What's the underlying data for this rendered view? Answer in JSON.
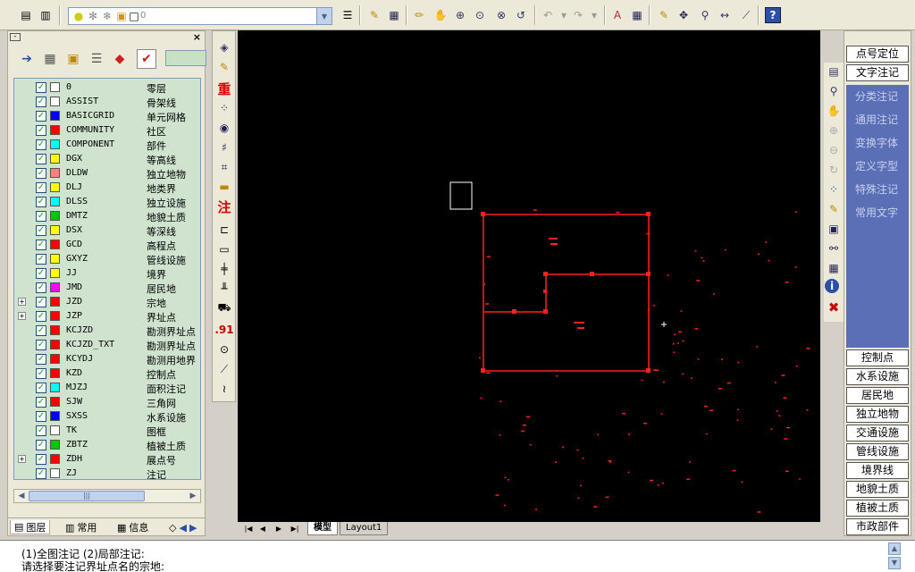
{
  "toolbar": {
    "layer_combo_value": "0"
  },
  "panel": {
    "layers": [
      {
        "name": "0",
        "desc": "零层",
        "color": "#ffffff",
        "expandable": false
      },
      {
        "name": "ASSIST",
        "desc": "骨架线",
        "color": "#ffffff",
        "expandable": false
      },
      {
        "name": "BASICGRID",
        "desc": "单元网格",
        "color": "#0000ff",
        "expandable": false
      },
      {
        "name": "COMMUNITY",
        "desc": "社区",
        "color": "#ff0000",
        "expandable": false
      },
      {
        "name": "COMPONENT",
        "desc": "部件",
        "color": "#00ffff",
        "expandable": false
      },
      {
        "name": "DGX",
        "desc": "等高线",
        "color": "#ffff00",
        "expandable": false
      },
      {
        "name": "DLDW",
        "desc": "独立地物",
        "color": "#ff8080",
        "expandable": false
      },
      {
        "name": "DLJ",
        "desc": "地类界",
        "color": "#ffff00",
        "expandable": false
      },
      {
        "name": "DLSS",
        "desc": "独立设施",
        "color": "#00ffff",
        "expandable": false
      },
      {
        "name": "DMTZ",
        "desc": "地貌土质",
        "color": "#00c800",
        "expandable": false
      },
      {
        "name": "DSX",
        "desc": "等深线",
        "color": "#ffff00",
        "expandable": false
      },
      {
        "name": "GCD",
        "desc": "高程点",
        "color": "#ff0000",
        "expandable": false
      },
      {
        "name": "GXYZ",
        "desc": "管线设施",
        "color": "#ffff00",
        "expandable": false
      },
      {
        "name": "JJ",
        "desc": "境界",
        "color": "#ffff00",
        "expandable": false
      },
      {
        "name": "JMD",
        "desc": "居民地",
        "color": "#ff00ff",
        "expandable": false
      },
      {
        "name": "JZD",
        "desc": "宗地",
        "color": "#ff0000",
        "expandable": true
      },
      {
        "name": "JZP",
        "desc": "界址点",
        "color": "#ff0000",
        "expandable": true
      },
      {
        "name": "KCJZD",
        "desc": "勘测界址点",
        "color": "#ff0000",
        "expandable": false
      },
      {
        "name": "KCJZD_TXT",
        "desc": "勘测界址点",
        "color": "#ff0000",
        "expandable": false
      },
      {
        "name": "KCYDJ",
        "desc": "勘测用地界",
        "color": "#ff0000",
        "expandable": false
      },
      {
        "name": "KZD",
        "desc": "控制点",
        "color": "#ff0000",
        "expandable": false
      },
      {
        "name": "MJZJ",
        "desc": "面积注记",
        "color": "#00ffff",
        "expandable": false
      },
      {
        "name": "SJW",
        "desc": "三角网",
        "color": "#ff0000",
        "expandable": false
      },
      {
        "name": "SXSS",
        "desc": "水系设施",
        "color": "#0000ff",
        "expandable": false
      },
      {
        "name": "TK",
        "desc": "图框",
        "color": "#ffffff",
        "expandable": false
      },
      {
        "name": "ZBTZ",
        "desc": "植被土质",
        "color": "#00c800",
        "expandable": false
      },
      {
        "name": "ZDH",
        "desc": "展点号",
        "color": "#ff0000",
        "expandable": true
      },
      {
        "name": "ZJ",
        "desc": "注记",
        "color": "#ffffff",
        "expandable": false
      }
    ],
    "tabs": [
      "图层",
      "常用",
      "信息"
    ]
  },
  "left_vtool": {
    "zhong_label": "重",
    "zhu_label": "注",
    "num_label": ".91"
  },
  "canvas_tabs": {
    "model": "模型",
    "layout1": "Layout1"
  },
  "right_panel": {
    "top_buttons": [
      "点号定位",
      "文字注记"
    ],
    "sub_items": [
      "分类注记",
      "通用注记",
      "变换字体",
      "定义字型",
      "特殊注记",
      "常用文字"
    ],
    "bottom_buttons": [
      "控制点",
      "水系设施",
      "居民地",
      "独立地物",
      "交通设施",
      "管线设施",
      "境界线",
      "地貌土质",
      "植被土质",
      "市政部件"
    ]
  },
  "command": {
    "line1": "(1)全图注记 (2)局部注记:",
    "line2": "请选择要注记界址点名的宗地:"
  },
  "colors": {
    "parcel": "#ff2020",
    "canvas": "#000000",
    "panel_list_bg": "#cfe3cf",
    "panel_blue": "#5a6fb5"
  }
}
